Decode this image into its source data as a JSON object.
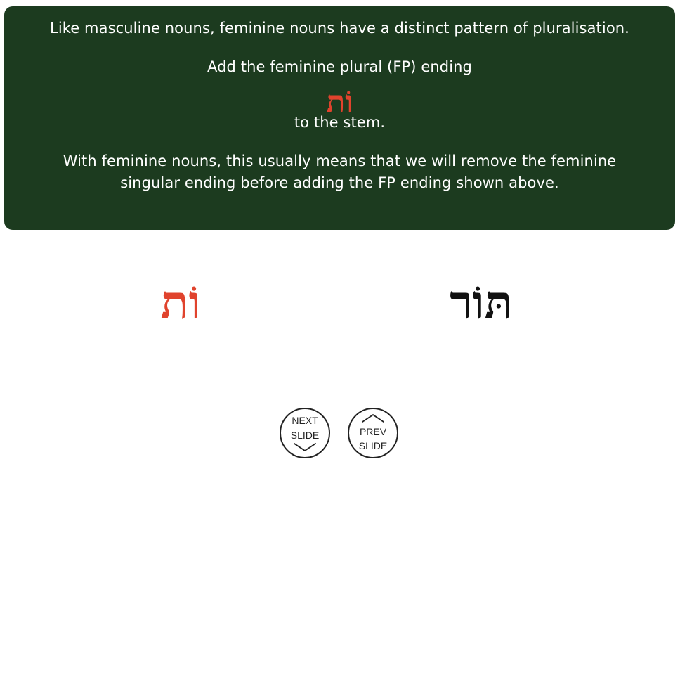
{
  "instructions": {
    "line1": "Like masculine nouns, feminine nouns have a distinct pattern of pluralisation.",
    "line2": "Add the feminine plural (FP) ending",
    "fp_ending": "וֹת",
    "line3": "to the stem.",
    "line4": "With feminine nouns, this usually means that we will remove the feminine singular ending before adding the FP ending shown above."
  },
  "display": {
    "suffix": "וֹת",
    "word": "תּוֹר"
  },
  "navigation": {
    "next_line1": "NEXT",
    "next_line2": "SLIDE",
    "next_icon": "chevron-down-icon",
    "prev_line1": "PREV",
    "prev_line2": "SLIDE",
    "prev_icon": "chevron-up-icon"
  },
  "colors": {
    "panel_bg": "#1c3b1f",
    "accent": "#e0432d",
    "text_light": "#ffffff"
  }
}
